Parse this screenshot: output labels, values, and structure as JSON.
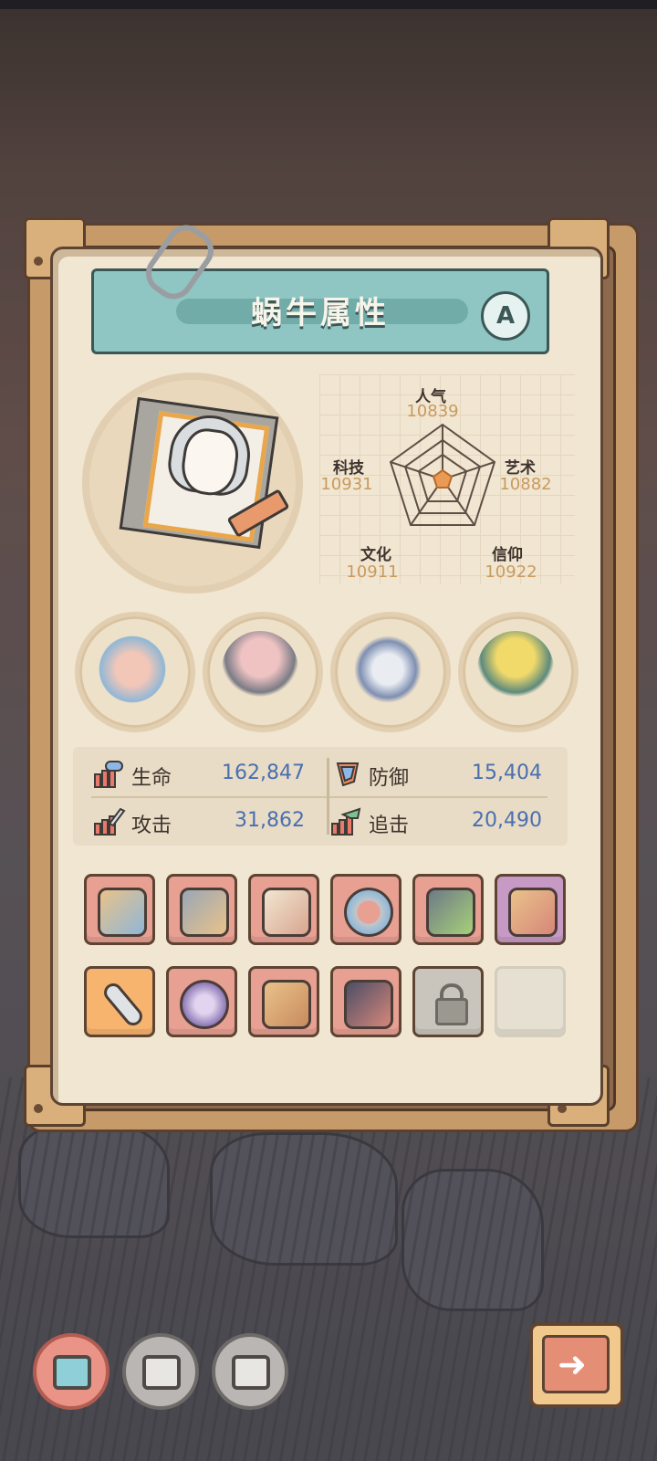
{
  "panel": {
    "title": "蜗牛属性",
    "grade": "A"
  },
  "radar": {
    "popularity": {
      "label": "人气",
      "value": "10839"
    },
    "art": {
      "label": "艺术",
      "value": "10882"
    },
    "faith": {
      "label": "信仰",
      "value": "10922"
    },
    "culture": {
      "label": "文化",
      "value": "10911"
    },
    "technology": {
      "label": "科技",
      "value": "10931"
    }
  },
  "stats": {
    "hp": {
      "label": "生命",
      "value": "162,847"
    },
    "defense": {
      "label": "防御",
      "value": "15,404"
    },
    "attack": {
      "label": "攻击",
      "value": "31,862"
    },
    "pursuit": {
      "label": "追击",
      "value": "20,490"
    }
  },
  "relics": [
    "bone-bundle-icon",
    "sprout-dome-icon",
    "compass-icon",
    "golden-fire-brazier-icon"
  ],
  "equipment_row1": [
    "crossbow-icon",
    "cannon-icon",
    "shirt-icon",
    "ring-icon",
    "lantern-hammer-icon",
    "umbrella-icon"
  ],
  "equipment_row2": [
    "sword-icon",
    "orb-icon",
    "torch-icon",
    "gauntlet-icon",
    "lock-icon",
    "empty-slot"
  ],
  "colors": {
    "title_bar": "#8fc6c3",
    "paper": "#f1e6d1",
    "stat_value": "#4a6fb0",
    "radar_value": "#c99a5e",
    "slot_red": "#e8a093",
    "slot_purple": "#c79ac6",
    "slot_orange": "#f7b46f"
  }
}
